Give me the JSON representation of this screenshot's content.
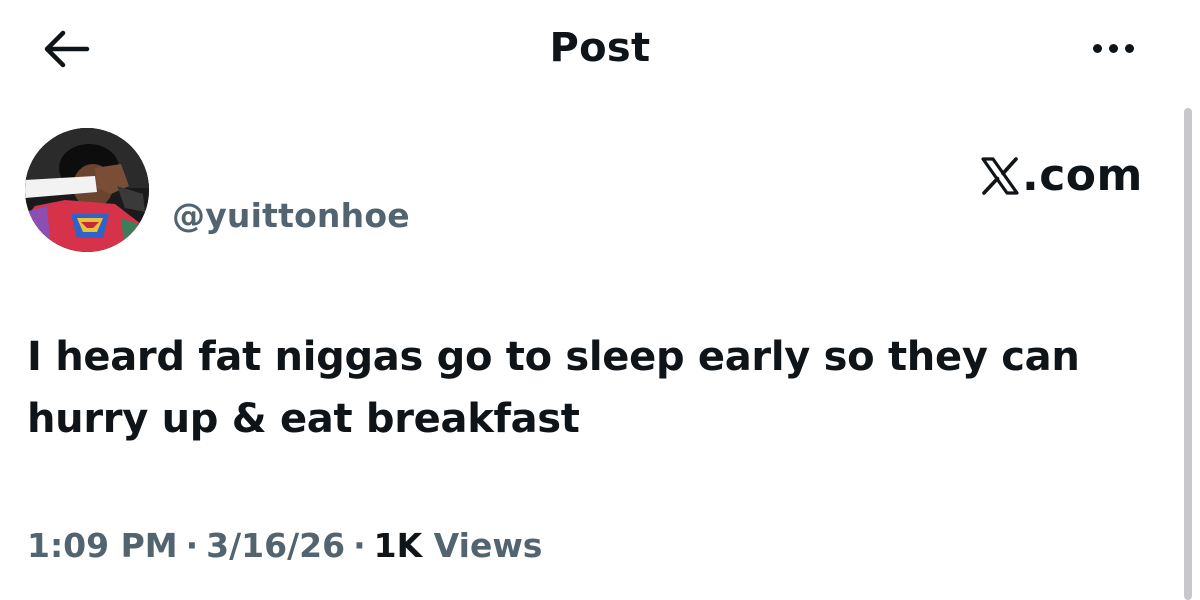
{
  "header": {
    "title": "Post",
    "back_icon": "arrow-left-icon",
    "more_icon": "ellipsis-horizontal-icon"
  },
  "author": {
    "handle": "@yuittonhoe",
    "avatar_icon": "profile-avatar"
  },
  "watermark": {
    "logo_icon": "x-logo-icon",
    "text": ".com"
  },
  "tweet": {
    "text": "I heard fat niggas go to sleep early so they can\nhurry up & eat breakfast"
  },
  "meta": {
    "time": "1:09 PM",
    "separator": "·",
    "date": "3/16/26",
    "views_count": "1K",
    "views_label": "Views"
  },
  "colors": {
    "primary_text": "#0f1419",
    "secondary_text": "#536471",
    "background": "#ffffff",
    "scrollbar": "#c7c7cc"
  }
}
